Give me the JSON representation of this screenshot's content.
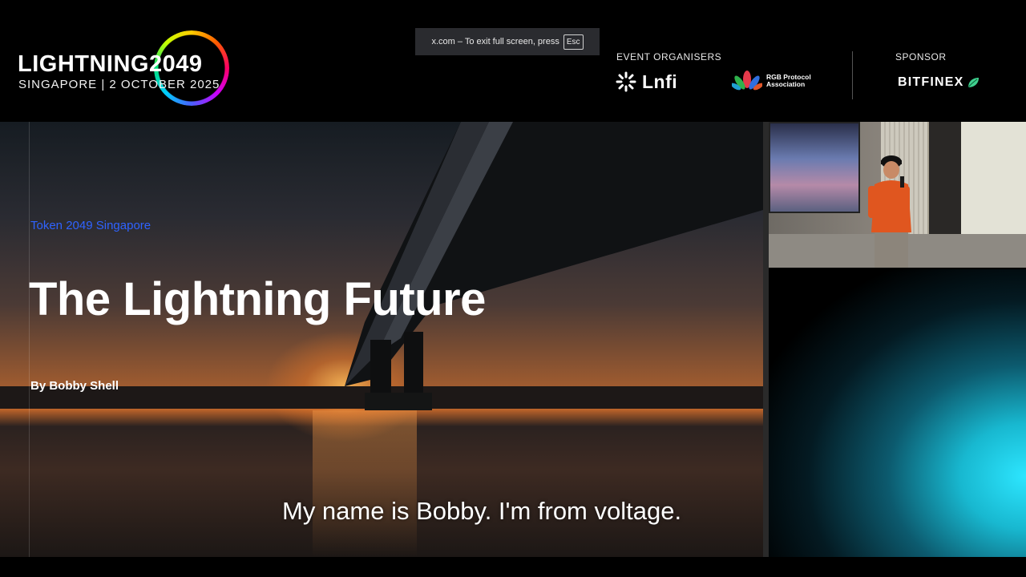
{
  "header": {
    "event_title": "LIGHTNING2049",
    "event_subtitle": "SINGAPORE | 2 OCTOBER 2025",
    "organisers_label": "EVENT ORGANISERS",
    "organisers": [
      {
        "name": "Lnfi"
      },
      {
        "name": "RGB Protocol Association"
      }
    ],
    "sponsor_label": "SPONSOR",
    "sponsor": "BITFINEX"
  },
  "fullscreen_notice": {
    "text": "x.com – To exit full screen, press",
    "key": "Esc"
  },
  "slide": {
    "tag": "Token 2049 Singapore",
    "title": "The Lightning Future",
    "author": "By Bobby Shell"
  },
  "caption": "My name is Bobby. I'm from voltage.",
  "colors": {
    "tag_blue": "#2f63ff",
    "glow_cyan": "#2de6ff",
    "sponsor_leaf": "#3fcf8e"
  }
}
